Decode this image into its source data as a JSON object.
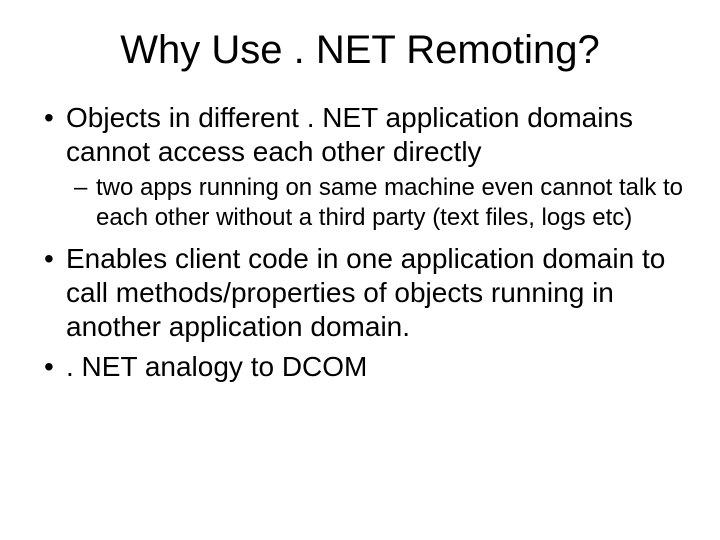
{
  "slide": {
    "title": "Why Use . NET Remoting?",
    "bullets": [
      {
        "text": "Objects in different . NET application domains cannot access each other directly",
        "sub": [
          {
            "text": "two apps running on same machine even cannot talk to each other without a third party (text files, logs etc)"
          }
        ]
      },
      {
        "text": "Enables client code in one application domain to call methods/properties of objects running in another application domain.",
        "sub": []
      },
      {
        "text": ". NET analogy to  DCOM",
        "sub": []
      }
    ]
  }
}
